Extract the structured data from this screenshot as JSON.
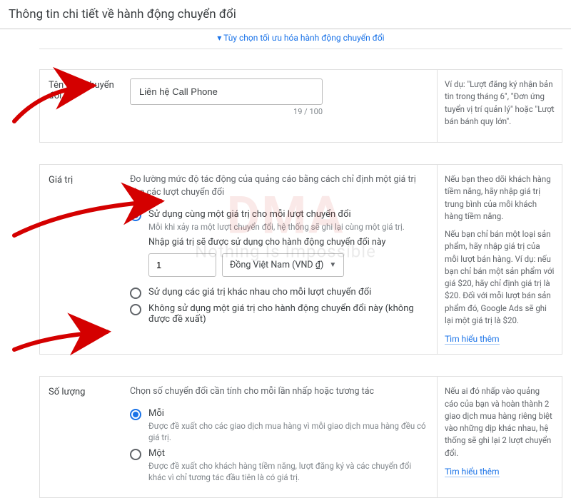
{
  "header": {
    "title": "Thông tin chi tiết về hành động chuyển đổi"
  },
  "top_link": {
    "text": "Tùy chọn tối ưu hóa hành động chuyển đổi",
    "chev": "▾"
  },
  "sections": {
    "name": {
      "label": "Tên lượt chuyển đổi",
      "value": "Liên hệ Call Phone",
      "count": "19 / 100",
      "help": "Ví dụ: \"Lượt đăng ký nhận bản tin trong tháng 6\", \"Đơn ứng tuyển vị trí quản lý\" hoặc \"Lượt bán bánh quy lớn\"."
    },
    "value": {
      "label": "Giá trị",
      "desc": "Đo lường mức độ tác động của quảng cáo bằng cách chỉ định một giá trị cho các lượt chuyển đổi",
      "opt1": "Sử dụng cùng một giá trị cho mỗi lượt chuyển đổi",
      "opt1_sub": "Mỗi khi xảy ra một lượt chuyển đổi, hệ thống sẽ ghi lại cùng một giá trị.",
      "enter_label": "Nhập giá trị sẽ được sử dụng cho hành động chuyển đổi này",
      "amount": "1",
      "currency": "Đồng Việt Nam (VND ₫)",
      "opt2": "Sử dụng các giá trị khác nhau cho mỗi lượt chuyển đổi",
      "opt3": "Không sử dụng một giá trị cho hành động chuyển đổi này (không được đề xuất)",
      "help1": "Nếu bạn theo dõi khách hàng tiềm năng, hãy nhập giá trị trung bình của mỗi khách hàng tiềm năng.",
      "help2": "Nếu bạn chỉ bán một loại sản phẩm, hãy nhập giá trị của mỗi lượt bán hàng. Ví dụ: nếu bạn chỉ bán một sản phẩm với giá $20, hãy chỉ định giá trị là $20. Đối với mỗi lượt bán sản phẩm đó, Google Ads sẽ ghi lại một giá trị là $20.",
      "learn": "Tìm hiểu thêm"
    },
    "count": {
      "label": "Số lượng",
      "desc": "Chọn số chuyển đổi cần tính cho mỗi lần nhấp hoặc tương tác",
      "opt1": "Mỗi",
      "opt1_sub": "Được đề xuất cho các giao dịch mua hàng vì mỗi giao dịch mua hàng đều có giá trị.",
      "opt2": "Một",
      "opt2_sub": "Được đề xuất cho khách hàng tiềm năng, lượt đăng ký và các chuyển đổi khác vì chỉ tương tác đầu tiên là có giá trị.",
      "help": "Nếu ai đó nhấp vào quảng cáo của bạn và hoàn thành 2 giao dịch mua hàng riêng biệt vào những dịp khác nhau, hệ thống sẽ ghi lại 2 lượt chuyển đổi.",
      "learn": "Tìm hiểu thêm"
    }
  },
  "watermark": {
    "big": "DMA",
    "tag": "Nothing Is Impossible"
  }
}
